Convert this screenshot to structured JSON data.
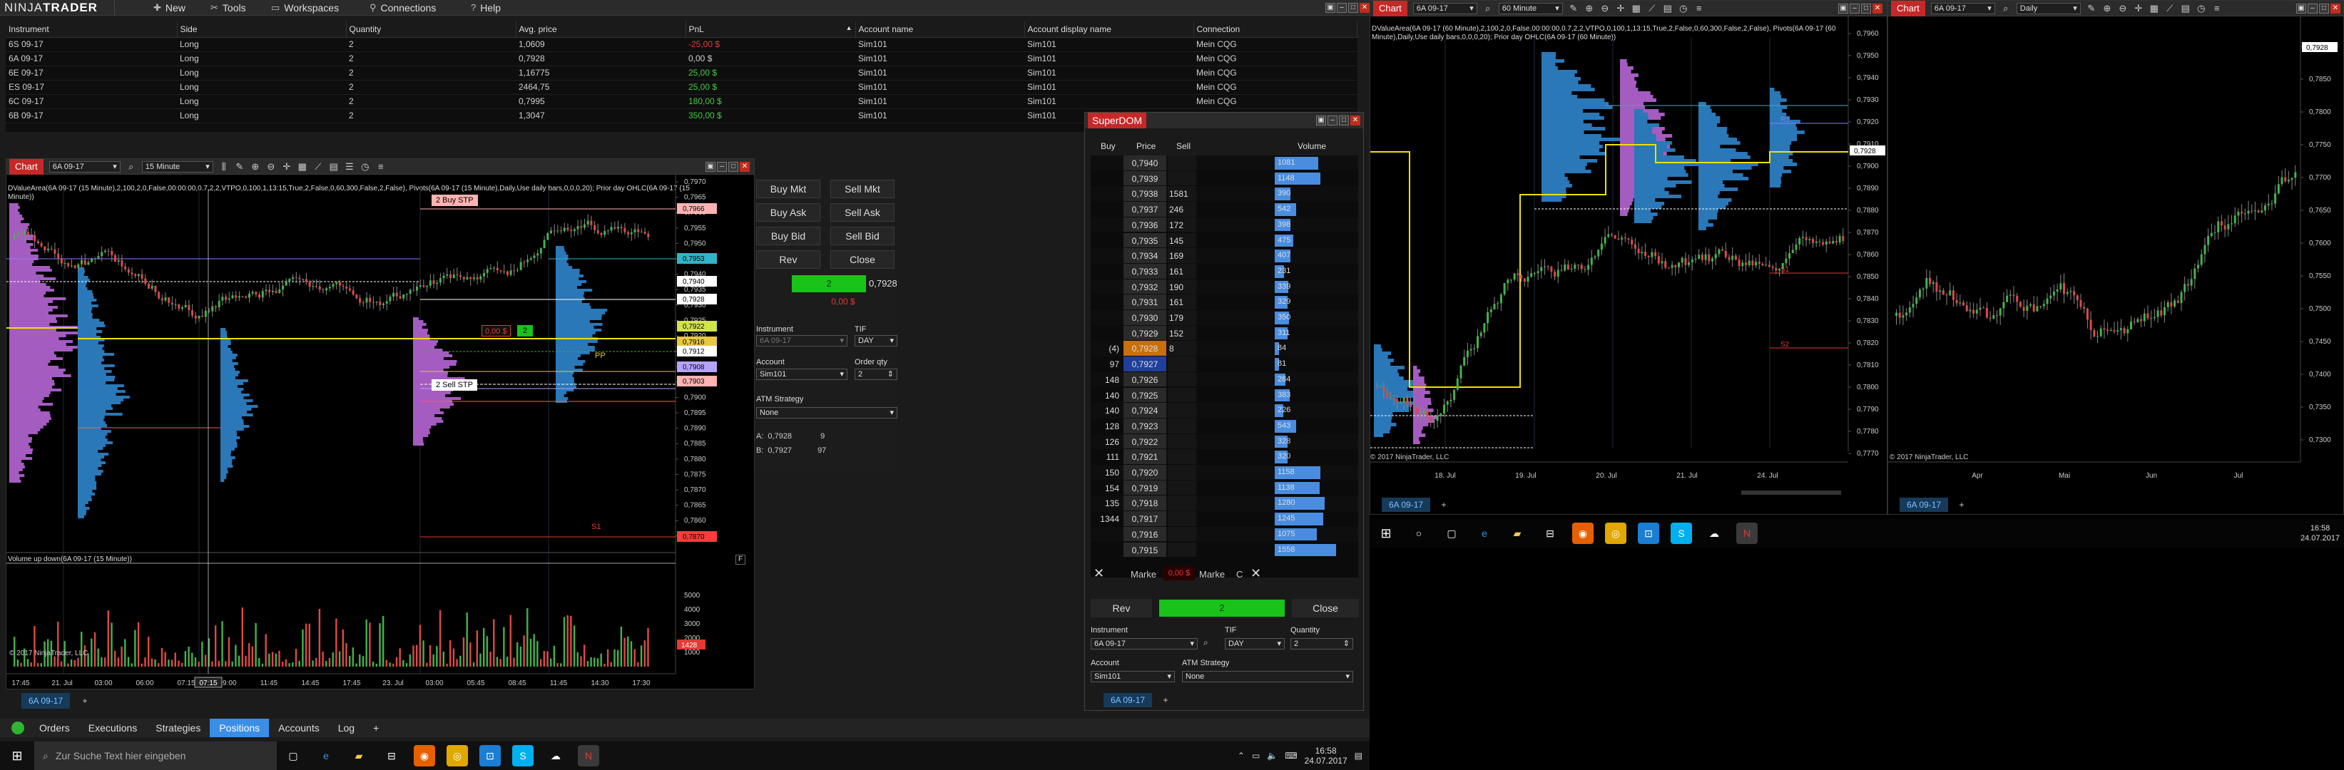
{
  "app": {
    "brand": "NINJATRADER",
    "brand_first": "NINJA",
    "brand_second": "TRADER",
    "menu": [
      {
        "label": "New",
        "icon": "new-icon"
      },
      {
        "label": "Tools",
        "icon": "tools-icon"
      },
      {
        "label": "Workspaces",
        "icon": "workspaces-icon"
      },
      {
        "label": "Connections",
        "icon": "connections-icon"
      },
      {
        "label": "Help",
        "icon": "help-icon"
      }
    ]
  },
  "positions": {
    "columns": [
      "Instrument",
      "Side",
      "Quantity",
      "Avg. price",
      "PnL",
      "Account name",
      "Account display name",
      "Connection"
    ],
    "rows": [
      {
        "instrument": "6S 09-17",
        "side": "Long",
        "qty": "2",
        "avg": "1,0609",
        "pnl": "-25,00 $",
        "pnl_sign": "neg",
        "account": "Sim101",
        "display": "Sim101",
        "connection": "Mein CQG"
      },
      {
        "instrument": "6A 09-17",
        "side": "Long",
        "qty": "2",
        "avg": "0,7928",
        "pnl": "0,00 $",
        "pnl_sign": "zero",
        "account": "Sim101",
        "display": "Sim101",
        "connection": "Mein CQG"
      },
      {
        "instrument": "6E 09-17",
        "side": "Long",
        "qty": "2",
        "avg": "1,16775",
        "pnl": "25,00 $",
        "pnl_sign": "pos",
        "account": "Sim101",
        "display": "Sim101",
        "connection": "Mein CQG"
      },
      {
        "instrument": "ES 09-17",
        "side": "Long",
        "qty": "2",
        "avg": "2464,75",
        "pnl": "25,00 $",
        "pnl_sign": "pos",
        "account": "Sim101",
        "display": "Sim101",
        "connection": "Mein CQG"
      },
      {
        "instrument": "6C 09-17",
        "side": "Long",
        "qty": "2",
        "avg": "0,7995",
        "pnl": "180,00 $",
        "pnl_sign": "pos",
        "account": "Sim101",
        "display": "Sim101",
        "connection": "Mein CQG"
      },
      {
        "instrument": "6B 09-17",
        "side": "Long",
        "qty": "2",
        "avg": "1,3047",
        "pnl": "350,00 $",
        "pnl_sign": "pos",
        "account": "Sim101",
        "display": "Sim101",
        "connection": "Mein CQG"
      }
    ]
  },
  "chart1": {
    "tab": "Chart",
    "instrument": "6A 09-17",
    "interval": "15 Minute",
    "indicator_line": "DValueArea(6A 09-17 (15 Minute),2,100,2,0,False,00:00:00,0.7,2,2,VTPO,0,100,1,13:15,True,2,False,0,60,300,False,2,False), Pivots(6A 09-17 (15 Minute),Daily,Use daily bars,0,0,0,20); Prior day OHLC(6A 09-17 (15 Minute))",
    "price_labels": [
      "0,7970",
      "0,7965",
      "0,7960",
      "0,7955",
      "0,7950",
      "0,7945",
      "0,7940",
      "0,7935",
      "0,7930",
      "0,7925",
      "0,7920",
      "0,7915",
      "0,7910",
      "0,7905",
      "0,7900",
      "0,7895",
      "0,7890",
      "0,7885",
      "0,7880",
      "0,7875",
      "0,7870",
      "0,7865",
      "0,7860",
      "0,7855"
    ],
    "price_badges": [
      {
        "text": "0,7966",
        "color": "#ffb3b3"
      },
      {
        "text": "0,7953",
        "color": "#2fb5c7"
      },
      {
        "text": "0,7940",
        "color": "#ffffff"
      },
      {
        "text": "0,7928",
        "color": "#ffffff"
      },
      {
        "text": "0,7922",
        "color": "#d3e34a"
      },
      {
        "text": "0,7916",
        "color": "#e8c840"
      },
      {
        "text": "0,7912",
        "color": "#ffffff"
      },
      {
        "text": "0,7908",
        "color": "#b7a3ff"
      },
      {
        "text": "0,7903",
        "color": "#ffb3b3"
      },
      {
        "text": "0,7870",
        "color": "#ff3b3b"
      }
    ],
    "orders": [
      {
        "label": "2 Buy STP"
      },
      {
        "label": "2 Sell STP"
      },
      {
        "label": "0,00 $"
      }
    ],
    "level_labels": [
      "S1",
      "PP"
    ],
    "volume_title": "Volume up down(6A 09-17 (15 Minute))",
    "volume_axis": [
      "5000",
      "4000",
      "3000",
      "2000",
      "1000"
    ],
    "volume_badge": "1428",
    "copyright": "© 2017 NinjaTrader, LLC",
    "time_labels": [
      "17:45",
      "21. Jul",
      "03:00",
      "06:00",
      "07:15",
      "09:00",
      "11:45",
      "14:45",
      "17:45",
      "23. Jul",
      "03:00",
      "05:45",
      "08:45",
      "11:45",
      "14:30",
      "17:30"
    ],
    "bottom_tab": "6A 09-17",
    "f_button": "F"
  },
  "chart_trader": {
    "buttons": [
      "Buy Mkt",
      "Sell Mkt",
      "Buy Ask",
      "Sell Ask",
      "Buy Bid",
      "Sell Bid",
      "Rev",
      "Close"
    ],
    "position_qty": "2",
    "position_price": "0,7928",
    "position_pnl": "0,00 $",
    "instrument_label": "Instrument",
    "instrument_value": "6A 09-17",
    "tif_label": "TIF",
    "tif_value": "DAY",
    "account_label": "Account",
    "account_value": "Sim101",
    "order_qty_label": "Order qty",
    "order_qty_value": "2",
    "atm_label": "ATM Strategy",
    "atm_value": "None",
    "ask_label": "A:",
    "ask_price": "0,7928",
    "ask_size": "9",
    "bid_label": "B:",
    "bid_price": "0,7927",
    "bid_size": "97"
  },
  "superdom": {
    "title": "SuperDOM",
    "headers": [
      "Buy",
      "Price",
      "Sell",
      "Volume"
    ],
    "rows": [
      {
        "buy": "",
        "price": "0,7940",
        "sell": "",
        "vol": "1081",
        "vw": 0.55
      },
      {
        "buy": "",
        "price": "0,7939",
        "sell": "",
        "vol": "1148",
        "vw": 0.58
      },
      {
        "buy": "",
        "price": "0,7938",
        "sell": "1581",
        "vol": "390",
        "vw": 0.2
      },
      {
        "buy": "",
        "price": "0,7937",
        "sell": "246",
        "vol": "542",
        "vw": 0.27
      },
      {
        "buy": "",
        "price": "0,7936",
        "sell": "172",
        "vol": "398",
        "vw": 0.2
      },
      {
        "buy": "",
        "price": "0,7935",
        "sell": "145",
        "vol": "475",
        "vw": 0.24
      },
      {
        "buy": "",
        "price": "0,7934",
        "sell": "169",
        "vol": "407",
        "vw": 0.2
      },
      {
        "buy": "",
        "price": "0,7933",
        "sell": "161",
        "vol": "231",
        "vw": 0.12
      },
      {
        "buy": "",
        "price": "0,7932",
        "sell": "190",
        "vol": "339",
        "vw": 0.17
      },
      {
        "buy": "",
        "price": "0,7931",
        "sell": "161",
        "vol": "329",
        "vw": 0.16
      },
      {
        "buy": "",
        "price": "0,7930",
        "sell": "179",
        "vol": "350",
        "vw": 0.18
      },
      {
        "buy": "",
        "price": "0,7929",
        "sell": "152",
        "vol": "311",
        "vw": 0.16
      },
      {
        "buy": "(4)",
        "price": "0,7928",
        "sell": "8",
        "vol": "84",
        "vw": 0.05,
        "hl": "orange"
      },
      {
        "buy": "97",
        "price": "0,7927",
        "sell": "",
        "vol": "81",
        "vw": 0.05,
        "hl": "blue"
      },
      {
        "buy": "148",
        "price": "0,7926",
        "sell": "",
        "vol": "284",
        "vw": 0.14
      },
      {
        "buy": "140",
        "price": "0,7925",
        "sell": "",
        "vol": "383",
        "vw": 0.19
      },
      {
        "buy": "140",
        "price": "0,7924",
        "sell": "",
        "vol": "226",
        "vw": 0.11
      },
      {
        "buy": "128",
        "price": "0,7923",
        "sell": "",
        "vol": "543",
        "vw": 0.27
      },
      {
        "buy": "126",
        "price": "0,7922",
        "sell": "",
        "vol": "328",
        "vw": 0.16
      },
      {
        "buy": "111",
        "price": "0,7921",
        "sell": "",
        "vol": "320",
        "vw": 0.16
      },
      {
        "buy": "150",
        "price": "0,7920",
        "sell": "",
        "vol": "1158",
        "vw": 0.58
      },
      {
        "buy": "154",
        "price": "0,7919",
        "sell": "",
        "vol": "1138",
        "vw": 0.57
      },
      {
        "buy": "135",
        "price": "0,7918",
        "sell": "",
        "vol": "1280",
        "vw": 0.64
      },
      {
        "buy": "1344",
        "price": "0,7917",
        "sell": "",
        "vol": "1245",
        "vw": 0.62
      },
      {
        "buy": "",
        "price": "0,7916",
        "sell": "",
        "vol": "1075",
        "vw": 0.54
      },
      {
        "buy": "",
        "price": "0,7915",
        "sell": "",
        "vol": "1558",
        "vw": 0.78
      }
    ],
    "market_left": "Marke",
    "market_pnl": "0,00 $",
    "market_right": "Marke",
    "market_c": "C",
    "rev": "Rev",
    "qty": "2",
    "close": "Close",
    "instrument_label": "Instrument",
    "instrument_value": "6A 09-17",
    "tif_label": "TIF",
    "tif_value": "DAY",
    "quantity_label": "Quantity",
    "quantity_value": "2",
    "account_label": "Account",
    "account_value": "Sim101",
    "atm_label": "ATM Strategy",
    "atm_value": "None",
    "bottom_tab": "6A 09-17"
  },
  "bottom_tabs": [
    "Orders",
    "Executions",
    "Strategies",
    "Positions",
    "Accounts",
    "Log"
  ],
  "bottom_tabs_active": "Positions",
  "taskbar_left": {
    "search_placeholder": "Zur Suche Text hier eingeben",
    "time": "16:58",
    "date": "24.07.2017"
  },
  "chart2": {
    "tab": "Chart",
    "instrument": "6A 09-17",
    "interval": "60 Minute",
    "indicator_line": "DValueArea(6A 09-17 (60 Minute),2,100,2,0,False,00:00:00,0.7,2,2,VTPO,0,100,1,13:15,True,2,False,0,60,300,False,2,False), Pivots(6A 09-17 (60 Minute),Daily,Use daily bars,0,0,0,20); Prior day OHLC(6A 09-17 (60 Minute))",
    "price_labels": [
      "0,7960",
      "0,7950",
      "0,7940",
      "0,7930",
      "0,7920",
      "0,7910",
      "0,7900",
      "0,7890",
      "0,7880",
      "0,7870",
      "0,7860",
      "0,7850",
      "0,7840",
      "0,7830",
      "0,7820",
      "0,7810",
      "0,7800",
      "0,7790",
      "0,7780",
      "0,7770"
    ],
    "current_badge": "0,7928",
    "level_labels": [
      "R1",
      "S1",
      "S2"
    ],
    "time_labels": [
      "18. Jul",
      "19. Jul",
      "20. Jul",
      "21. Jul",
      "24. Jul"
    ],
    "copyright": "© 2017 NinjaTrader, LLC",
    "bottom_tab": "6A 09-17"
  },
  "chart3": {
    "tab": "Chart",
    "instrument": "6A 09-17",
    "interval": "Daily",
    "price_labels": [
      "0,7900",
      "0,7850",
      "0,7800",
      "0,7750",
      "0,7700",
      "0,7650",
      "0,7600",
      "0,7550",
      "0,7500",
      "0,7450",
      "0,7400",
      "0,7350",
      "0,7300"
    ],
    "current_badge": "0,7928",
    "time_labels": [
      "Apr",
      "Mai",
      "Jun",
      "Jul"
    ],
    "copyright": "© 2017 NinjaTrader, LLC",
    "bottom_tab": "6A 09-17"
  },
  "taskbar_right": {
    "time": "16:58",
    "date": "24.07.2017"
  },
  "colors": {
    "accent_red": "#c62828",
    "profile_magenta": "#b062c4",
    "profile_blue": "#2a78b8",
    "candle_up": "#3fb54a",
    "candle_down": "#e04848",
    "poc_yellow": "#f0e000",
    "active_tab": "#3a8ee6"
  }
}
